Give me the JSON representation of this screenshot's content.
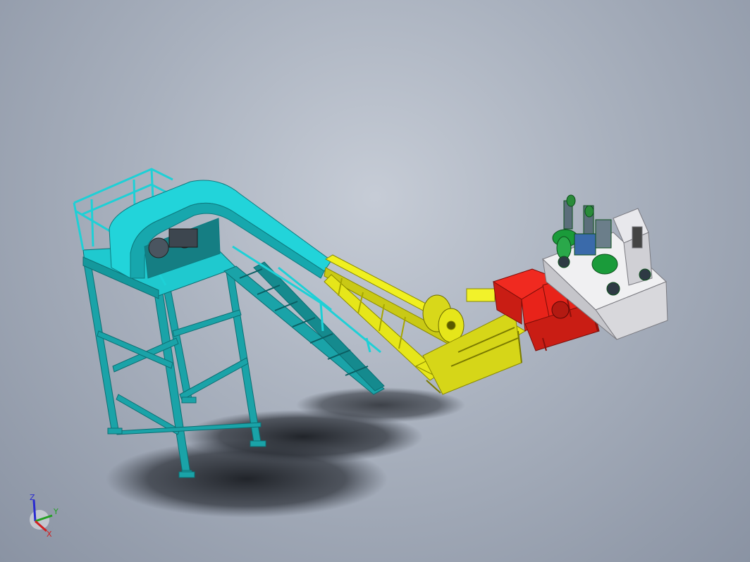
{
  "viewport": {
    "background_colors": [
      "#c6ccd6",
      "#8a93a3"
    ],
    "component_colors": {
      "platform_conveyor": "#1fc9cf",
      "platform_frame": "#1aa3a8",
      "incline_conveyor": "#e6e61a",
      "feed_bin": "#e8231a",
      "machine_base": "#e0e0e4",
      "motors": "#1a9b3a"
    }
  },
  "triad": {
    "z_label": "Z",
    "y_label": "Y",
    "x_label": "X",
    "z_color": "#2a2ad0",
    "y_color": "#22a022",
    "x_color": "#d02020"
  }
}
